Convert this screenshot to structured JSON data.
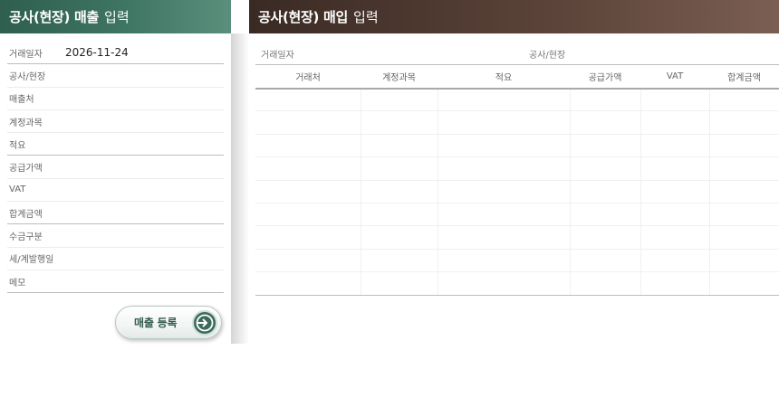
{
  "sales_panel": {
    "title_strong": "공사(현장) 매출",
    "title_light": "입력",
    "rows": [
      {
        "label": "거래일자",
        "value": "2026-11-24"
      },
      {
        "label": "공사/현장",
        "value": ""
      },
      {
        "label": "매출처",
        "value": ""
      },
      {
        "label": "계정과목",
        "value": ""
      },
      {
        "label": "적요",
        "value": ""
      },
      {
        "label": "공급가액",
        "value": ""
      },
      {
        "label": "VAT",
        "value": ""
      },
      {
        "label": "합계금액",
        "value": ""
      },
      {
        "label": "수금구분",
        "value": ""
      },
      {
        "label": "세/계발행일",
        "value": ""
      },
      {
        "label": "메모",
        "value": ""
      }
    ],
    "register_button_label": "매출 등록",
    "register_button_icon": "arrow-right-circle-icon"
  },
  "purchase_panel": {
    "title_strong": "공사(현장) 매입",
    "title_light": "입력",
    "filter_date_label": "거래일자",
    "filter_site_label": "공사/현장",
    "columns": [
      "거래처",
      "계정과목",
      "적요",
      "공급가액",
      "VAT",
      "합계금액"
    ],
    "rows": [
      [
        "",
        "",
        "",
        "",
        "",
        ""
      ],
      [
        "",
        "",
        "",
        "",
        "",
        ""
      ],
      [
        "",
        "",
        "",
        "",
        "",
        ""
      ],
      [
        "",
        "",
        "",
        "",
        "",
        ""
      ],
      [
        "",
        "",
        "",
        "",
        "",
        ""
      ],
      [
        "",
        "",
        "",
        "",
        "",
        ""
      ],
      [
        "",
        "",
        "",
        "",
        "",
        ""
      ],
      [
        "",
        "",
        "",
        "",
        "",
        ""
      ],
      [
        "",
        "",
        "",
        "",
        "",
        ""
      ]
    ]
  },
  "colors": {
    "sales_header": "#3f7563",
    "purchase_header": "#5a4238",
    "button_accent": "#3d6b5b"
  }
}
